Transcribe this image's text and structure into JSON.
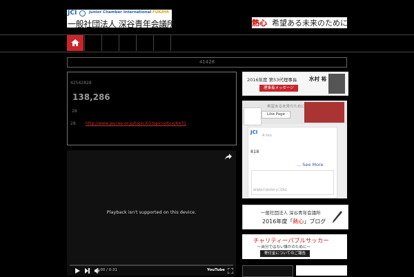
{
  "header": {
    "logo_jci": "JCI",
    "logo_name": "Junior Chamber International",
    "logo_region": "FUKAYA",
    "org_name": "一般社団法人 深谷青年会議所",
    "slogan_red": "熱心",
    "slogan_rest": "希望ある未来のために"
  },
  "nav": {
    "home_icon": "home-icon"
  },
  "breadcrumb": "41428",
  "post": {
    "id_line": "42542828",
    "count": "138,286",
    "line_a": "28",
    "line_b": "28",
    "link": "http://www.jaycee.or.jp/topic/01topicnotice/6431"
  },
  "video": {
    "message": "Playback isn't supported on this device.",
    "time": "0:00 / 0:31",
    "youtube": "YouTube"
  },
  "sidebar": {
    "chair_year": "2016年度 第53代理事長",
    "chair_name": "水村 裕",
    "chair_button": "理事長メッセージ",
    "fb_slogan": "希望ある未来のために",
    "fb_like": "Like Page",
    "fb_time": "4 hrs",
    "fb_post_text": "818",
    "fb_see_more": "... See More",
    "fb_url": "WWW.FUKAYA-JC.ORG",
    "blog_line1": "一般社団法人 深谷青年会議所",
    "blog_line2_a": "2016年度「",
    "blog_line2_red": "熱心",
    "blog_line2_b": "」ブログ",
    "charity_title": "チャリティーパブルサッカー",
    "charity_sub": "〜自分ではない誰かのために〜",
    "charity_button": "寄付金についてのご報告"
  },
  "colors": {
    "accent_red": "#c8262b",
    "jci_blue": "#1a5fb4",
    "fb_blue": "#3b5998"
  }
}
